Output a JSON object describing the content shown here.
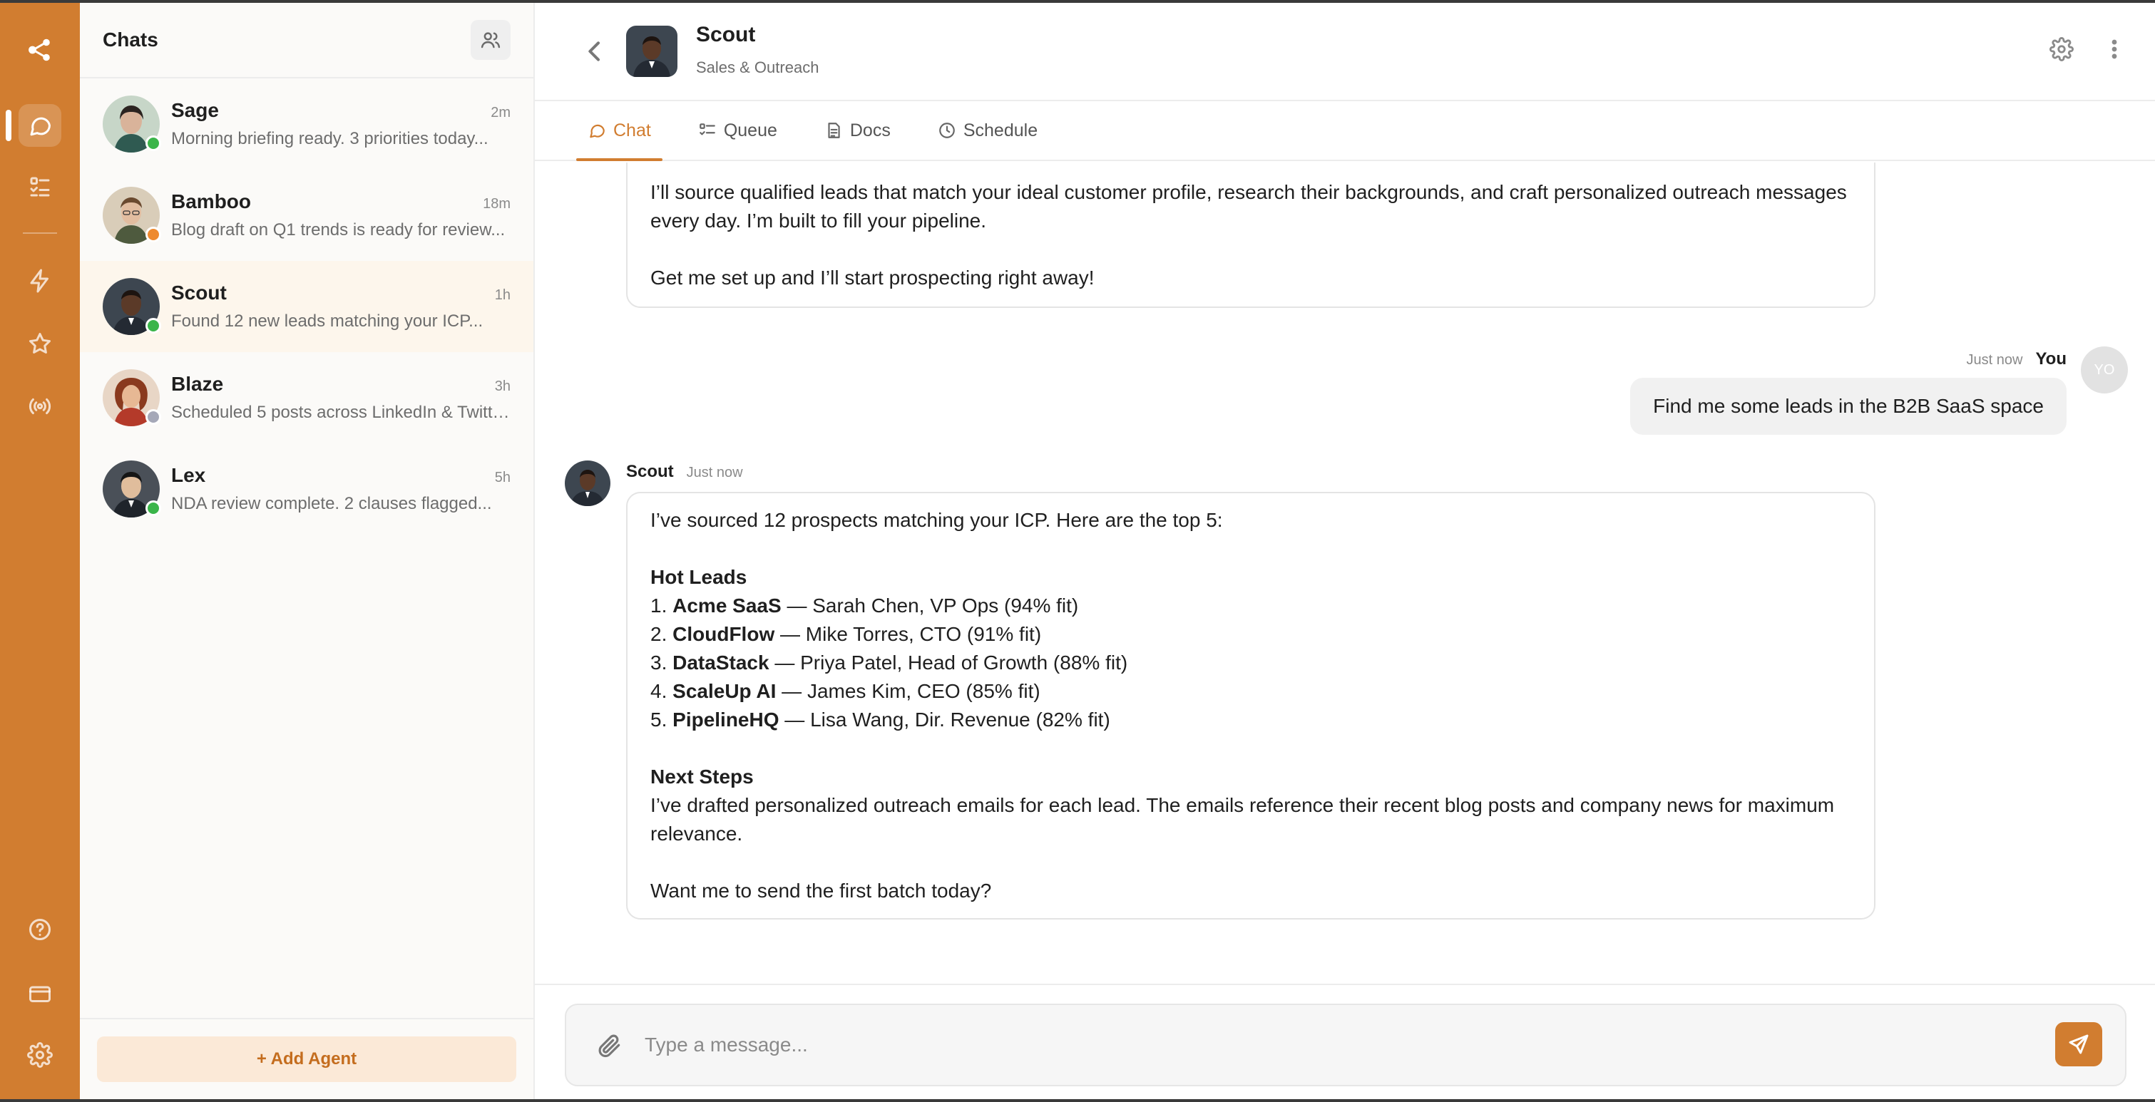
{
  "theme": {
    "accent": "#D17D30",
    "online": "#3bb54a",
    "away": "#ee8a2f",
    "offline": "#a5a8b8"
  },
  "rail": {
    "items": [
      "logo-icon",
      "chat-bubble-icon",
      "tasks-list-icon",
      "lightning-icon",
      "star-icon",
      "broadcast-icon",
      "help-circle-icon",
      "credit-card-icon",
      "gear-icon"
    ],
    "active": "chat-bubble-icon"
  },
  "chat_list": {
    "title": "Chats",
    "add_agent_label": "+ Add Agent",
    "items": [
      {
        "name": "Sage",
        "time": "2m",
        "preview": "Morning briefing ready. 3 priorities today...",
        "status": "online"
      },
      {
        "name": "Bamboo",
        "time": "18m",
        "preview": "Blog draft on Q1 trends is ready for review...",
        "status": "away"
      },
      {
        "name": "Scout",
        "time": "1h",
        "preview": "Found 12 new leads matching your ICP...",
        "status": "online",
        "selected": true
      },
      {
        "name": "Blaze",
        "time": "3h",
        "preview": "Scheduled 5 posts across LinkedIn & Twitter...",
        "status": "offline"
      },
      {
        "name": "Lex",
        "time": "5h",
        "preview": "NDA review complete. 2 clauses flagged...",
        "status": "online"
      }
    ]
  },
  "header": {
    "name": "Scout",
    "subtitle": "Sales & Outreach"
  },
  "tabs": [
    {
      "label": "Chat",
      "icon": "chat-bubble-icon",
      "active": true
    },
    {
      "label": "Queue",
      "icon": "queue-list-icon"
    },
    {
      "label": "Docs",
      "icon": "document-icon"
    },
    {
      "label": "Schedule",
      "icon": "clock-icon"
    }
  ],
  "messages": {
    "intro": {
      "p1": "I’ll source qualified leads that match your ideal customer profile, research their backgrounds, and craft personalized outreach messages every day. I’m built to fill your pipeline.",
      "p2": "Get me set up and I’ll start prospecting right away!"
    },
    "user": {
      "time": "Just now",
      "name": "You",
      "initials": "YO",
      "text": "Find me some leads in the B2B SaaS space"
    },
    "bot": {
      "name": "Scout",
      "time": "Just now",
      "intro": "I’ve sourced 12 prospects matching your ICP. Here are the top 5:",
      "hot_heading": "Hot Leads",
      "leads": [
        {
          "num": "1.",
          "company": "Acme SaaS",
          "detail": "— Sarah Chen, VP Ops (94% fit)"
        },
        {
          "num": "2.",
          "company": "CloudFlow",
          "detail": "— Mike Torres, CTO (91% fit)"
        },
        {
          "num": "3.",
          "company": "DataStack",
          "detail": "— Priya Patel, Head of Growth (88% fit)"
        },
        {
          "num": "4.",
          "company": "ScaleUp AI",
          "detail": "— James Kim, CEO (85% fit)"
        },
        {
          "num": "5.",
          "company": "PipelineHQ",
          "detail": "— Lisa Wang, Dir. Revenue (82% fit)"
        }
      ],
      "next_heading": "Next Steps",
      "next_text": "I’ve drafted personalized outreach emails for each lead. The emails reference their recent blog posts and company news for maximum relevance.",
      "closing": "Want me to send the first batch today?"
    }
  },
  "composer": {
    "placeholder": "Type a message..."
  }
}
